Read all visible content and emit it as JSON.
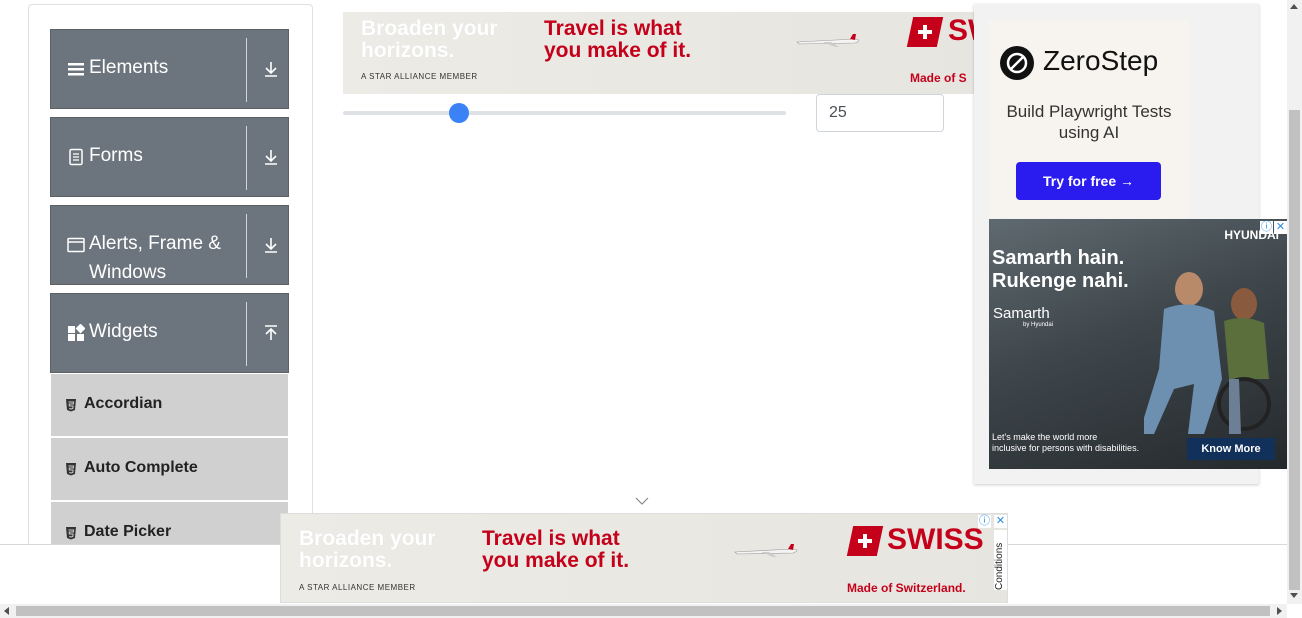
{
  "sidebar": {
    "groups": [
      {
        "label": "Elements",
        "icon": "bars-icon",
        "expanded": false
      },
      {
        "label": "Forms",
        "icon": "document-icon",
        "expanded": false
      },
      {
        "label": "Alerts, Frame &",
        "label2": "Windows",
        "icon": "window-icon",
        "expanded": false
      },
      {
        "label": "Widgets",
        "icon": "widgets-icon",
        "expanded": true
      }
    ],
    "widget_items": [
      "Accordian",
      "Auto Complete",
      "Date Picker"
    ]
  },
  "slider": {
    "value": "25",
    "fraction": 0.25
  },
  "ads": {
    "swiss": {
      "line1a": "Broaden your",
      "line1b": "horizons.",
      "line2a": "Travel is what",
      "line2b": "you make of it.",
      "member": "A STAR ALLIANCE MEMBER",
      "brand": "SWISS",
      "brand_partial": "SW",
      "made": "Made of Switzerland.",
      "made_partial": "Made of S",
      "conditions": "Conditions"
    },
    "zerostep": {
      "brand": "ZeroStep",
      "tagline": "Build Playwright Tests using AI",
      "cta": "Try for free →"
    },
    "hyundai": {
      "headline1": "Samarth hain.",
      "headline2": "Rukenge nahi.",
      "brand": "HYUNDAI",
      "program": "Samarth",
      "program_sub": "by Hyundai",
      "footer1": "Let's make the world more",
      "footer2": "inclusive for persons with disabilities.",
      "cta": "Know More"
    }
  },
  "colors": {
    "sidebar_header": "#6c757d",
    "subitem_bg": "#d0d0d0",
    "slider_thumb": "#3b82f6",
    "swiss_red": "#c4001a",
    "zerostep_btn": "#2a1bef"
  }
}
